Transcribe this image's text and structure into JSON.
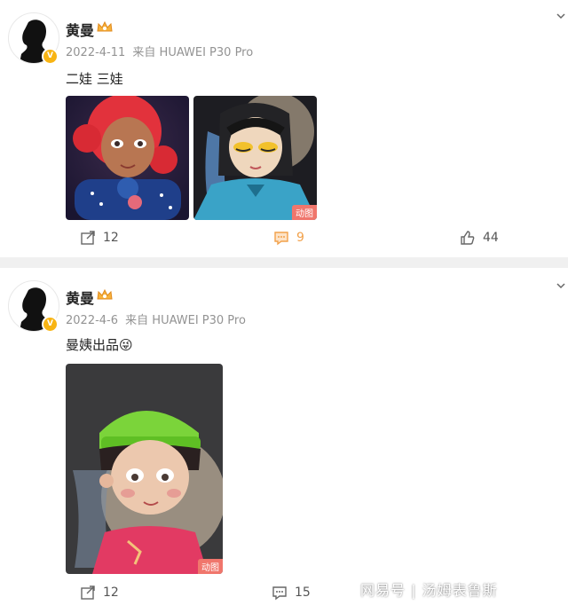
{
  "posts": [
    {
      "author": "黄曼",
      "date": "2022-4-11",
      "source": "来自 HUAWEI P30 Pro",
      "text": "二娃 三娃",
      "images": [
        {
          "badge": ""
        },
        {
          "badge": "动图"
        }
      ],
      "actions": {
        "forward": "12",
        "comment": "9",
        "like": "44"
      }
    },
    {
      "author": "黄曼",
      "date": "2022-4-6",
      "source": "来自 HUAWEI P30 Pro",
      "text": "曼姨出品😜",
      "images": [
        {
          "badge": "动图"
        }
      ],
      "actions": {
        "forward": "12",
        "comment": "15"
      }
    }
  ],
  "watermark": "网易号 | 汤姆表鲁斯",
  "colors": {
    "accent": "#f8b413",
    "active": "#f2a14a",
    "gif_badge": "#f0766c"
  }
}
